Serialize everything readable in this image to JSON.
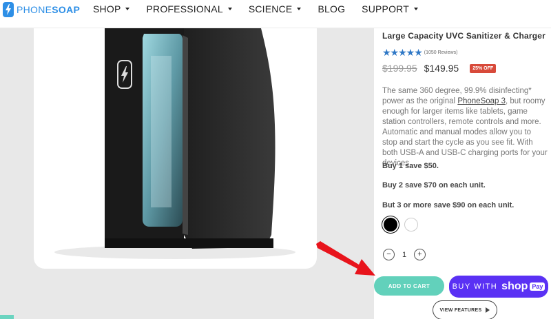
{
  "header": {
    "logo": {
      "phone": "PHONE",
      "soap": "SOAP"
    },
    "nav": [
      {
        "label": "SHOP",
        "has_caret": true
      },
      {
        "label": "PROFESSIONAL",
        "has_caret": true
      },
      {
        "label": "SCIENCE",
        "has_caret": true
      },
      {
        "label": "BLOG",
        "has_caret": false
      },
      {
        "label": "SUPPORT",
        "has_caret": true
      }
    ]
  },
  "product": {
    "title": "Large Capacity UVC Sanitizer & Charger",
    "rating": {
      "stars": 4.5,
      "reviews": "(1050 Reviews)"
    },
    "price_old": "$199.95",
    "price_new": "$149.95",
    "badge": "25% OFF",
    "description": {
      "before_link": "The same 360 degree, 99.9% disinfecting* power as the original ",
      "link": "PhoneSoap 3",
      "after_link": ", but roomy enough for larger items like tablets, game station controllers, remote controls and more. Automatic and manual modes allow you to stop and start the cycle as you see fit. With both USB-A and USB-C charging ports for your devices."
    },
    "offers": [
      "Buy 1 save $50.",
      "Buy 2 save $70 on each unit.",
      "But 3 or more save $90 on each unit."
    ],
    "colors": [
      {
        "name": "black",
        "hex": "#000000",
        "selected": true
      },
      {
        "name": "white",
        "hex": "#ffffff",
        "selected": false
      }
    ],
    "quantity": "1",
    "quantity_minus": "−",
    "quantity_plus": "+",
    "add_to_cart": "ADD TO CART",
    "shop_pay": {
      "buy_with": "BUY WITH",
      "shop": "shop",
      "pay": "Pay"
    },
    "view_features": "VIEW FEATURES"
  },
  "colors": {
    "brand_blue": "#2e8fe6",
    "star_blue": "#2f78c6",
    "badge_red": "#d84a3a",
    "cart_teal": "#62d1bb",
    "shop_pay_purple": "#5a31f4",
    "annotation_red": "#e8141c"
  },
  "icons": {
    "logo": "lightning-bolt-icon",
    "nav_caret": "caret-down-icon",
    "view_features": "play-icon",
    "annotation": "red-arrow-icon"
  }
}
